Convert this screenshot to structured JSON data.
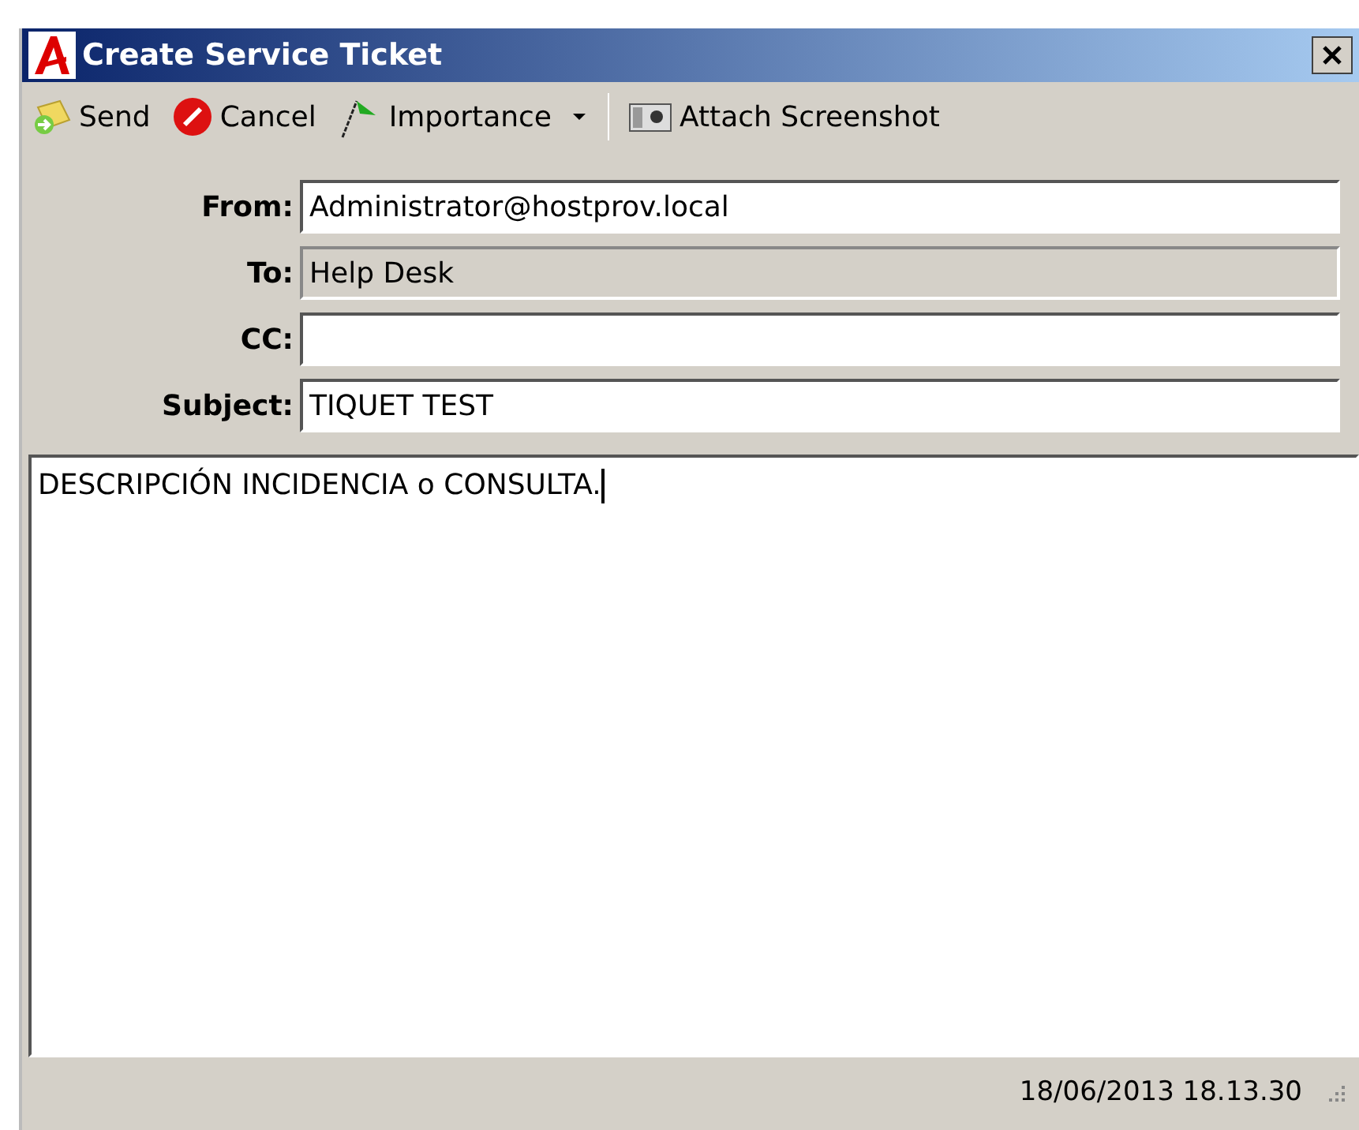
{
  "window": {
    "title": "Create Service Ticket"
  },
  "toolbar": [
    {
      "kind": "send",
      "label": "Send"
    },
    {
      "kind": "cancel",
      "label": "Cancel"
    },
    {
      "kind": "importance",
      "label": "Importance"
    },
    {
      "kind": "separator"
    },
    {
      "kind": "screenshot",
      "label": "Attach Screenshot"
    }
  ],
  "fields": [
    {
      "label": "From:",
      "value": "Administrator@hostprov.local",
      "disabled": false
    },
    {
      "label": "To:",
      "value": "Help Desk",
      "disabled": true
    },
    {
      "label": "CC:",
      "disabled": false
    },
    {
      "label": "Subject:",
      "value": "TIQUET TEST",
      "disabled": false
    }
  ],
  "body": {
    "value": "DESCRIPCIÓN INCIDENCIA o CONSULTA."
  },
  "status_bar": {
    "timestamp": "18/06/2013 18.13.30"
  }
}
